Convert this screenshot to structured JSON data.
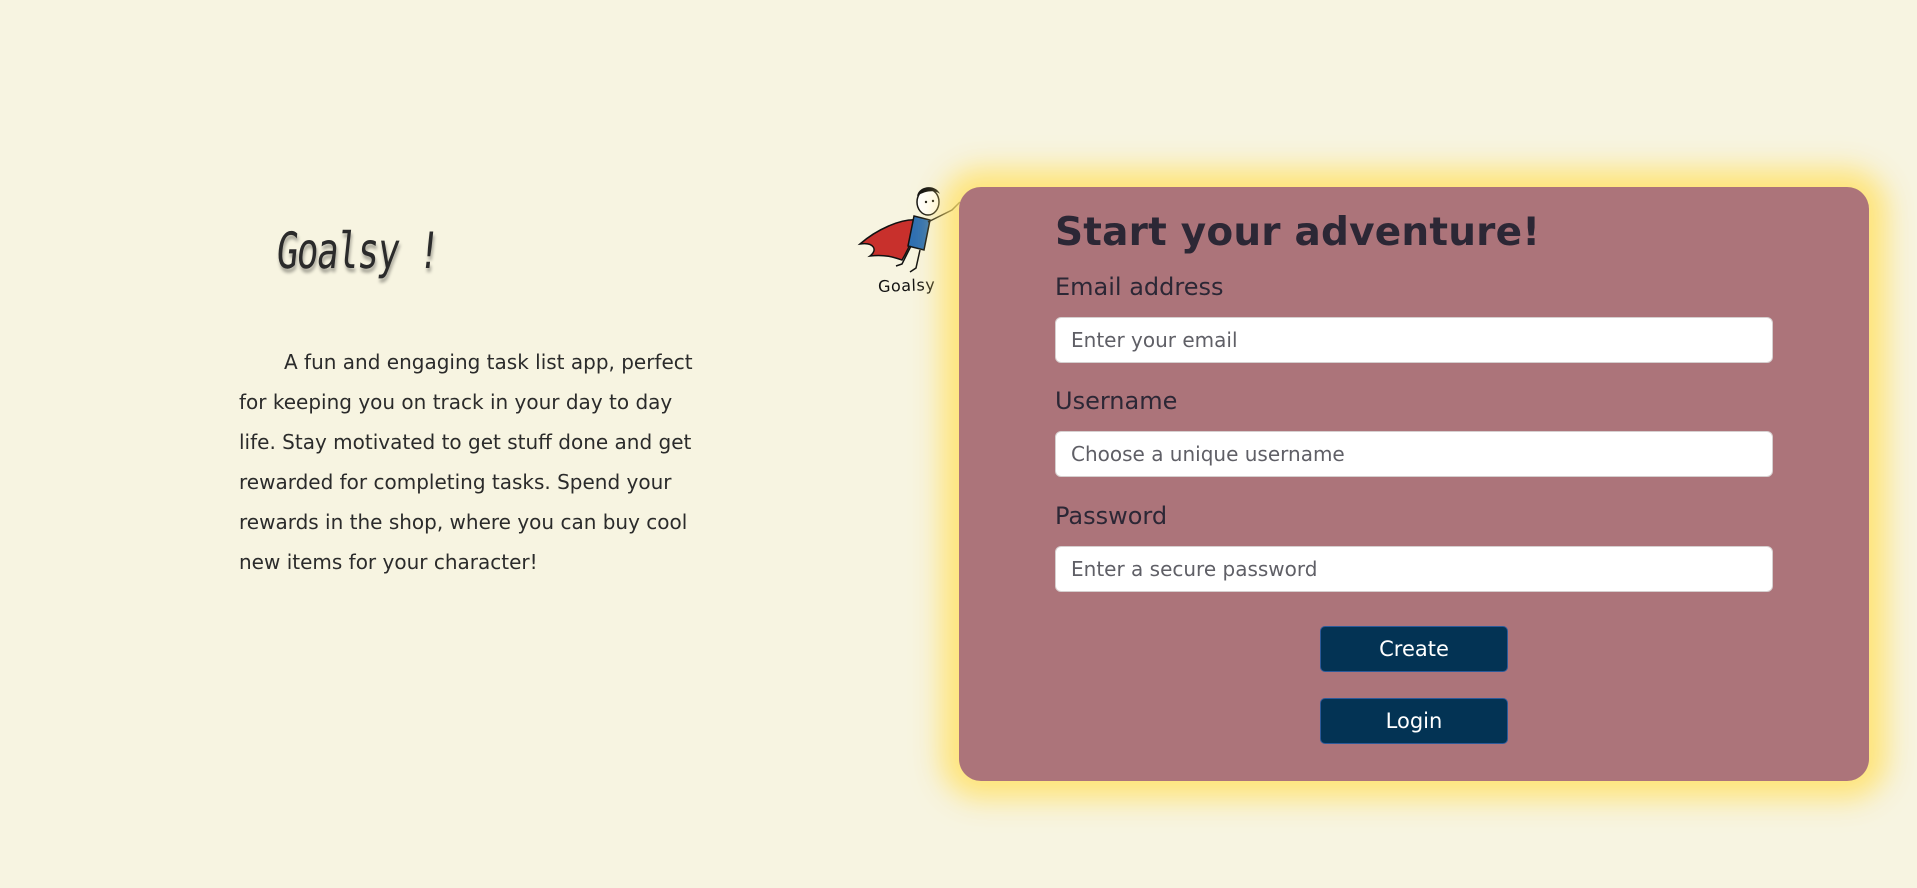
{
  "intro": {
    "brand_title": "Goalsy !",
    "description": "A fun and engaging task list app, perfect for keeping you on track in your day to day life. Stay motivated to get stuff done and get rewarded for completing tasks. Spend your rewards in the shop, where you can buy cool new items for your character!"
  },
  "mascot": {
    "icon": "superhero-mascot-icon",
    "caption": "Goalsy"
  },
  "signup": {
    "title": "Start your adventure!",
    "email": {
      "label": "Email address",
      "placeholder": "Enter your email",
      "value": ""
    },
    "username": {
      "label": "Username",
      "placeholder": "Choose a unique username",
      "value": ""
    },
    "password": {
      "label": "Password",
      "placeholder": "Enter a secure password",
      "value": ""
    },
    "create_label": "Create",
    "login_label": "Login"
  },
  "colors": {
    "background": "#f7f4e1",
    "card": "#ac747a",
    "card_glow": "#ffe26e",
    "button": "#033354",
    "text_dark": "#2c2735"
  }
}
